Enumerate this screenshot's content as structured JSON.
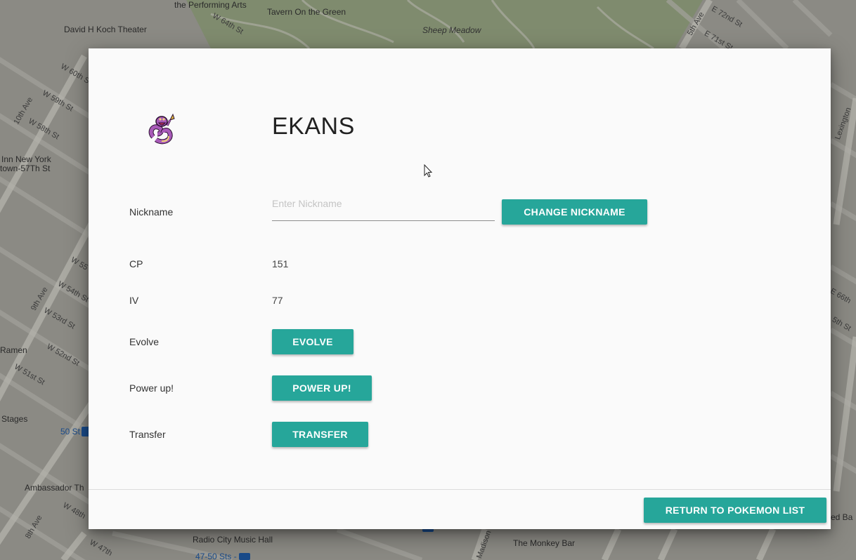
{
  "map": {
    "labels": {
      "performing_arts": "the Performing Arts",
      "tavern": "Tavern On the Green",
      "sheep_meadow": "Sheep Meadow",
      "koch_theater": "David H Koch Theater",
      "w64": "W 64th St",
      "w60": "W 60th St",
      "w59": "W 59th St",
      "w58": "W 58th St",
      "tenth_ave": "10th Ave",
      "inn_ny_1": "Inn New York",
      "inn_ny_2": "town-57Th St",
      "w55": "W 55",
      "w54": "W 54th St",
      "w53": "W 53rd St",
      "ninth_ave": "9th Ave",
      "w52": "W 52nd St",
      "w51": "W 51st St",
      "ramen": "Ramen",
      "stages": "Stages",
      "st50": "50 St",
      "ambassador": "Ambassador Th",
      "w48": "W 48th",
      "eighth_ave": "8th Ave",
      "w47": "W 47th",
      "radio_city": "Radio City Music Hall",
      "sts_4750": "47-50 Sts -",
      "monkey_bar": "The Monkey Bar",
      "madison": "Madison",
      "fifth_ave": "5th Ave",
      "e72": "E 72nd St",
      "e71": "E 71st St",
      "lexington": "Lexington",
      "e66": "E 66th",
      "fifth_st": "5th St",
      "ed": "ed Ba"
    }
  },
  "pokemon": {
    "name": "EKANS",
    "sprite_icon": "ekans-sprite"
  },
  "fields": {
    "nickname": {
      "label": "Nickname",
      "value": "",
      "placeholder": "Enter Nickname",
      "button": "CHANGE NICKNAME"
    },
    "cp": {
      "label": "CP",
      "value": "151"
    },
    "iv": {
      "label": "IV",
      "value": "77"
    },
    "evolve": {
      "label": "Evolve",
      "button": "EVOLVE"
    },
    "power_up": {
      "label": "Power up!",
      "button": "POWER UP!"
    },
    "transfer": {
      "label": "Transfer",
      "button": "TRANSFER"
    }
  },
  "footer": {
    "return_button": "RETURN TO POKEMON LIST"
  },
  "colors": {
    "accent": "#26a69a",
    "dialog_bg": "#fafafa",
    "map_overlay": "#8b8a84"
  }
}
